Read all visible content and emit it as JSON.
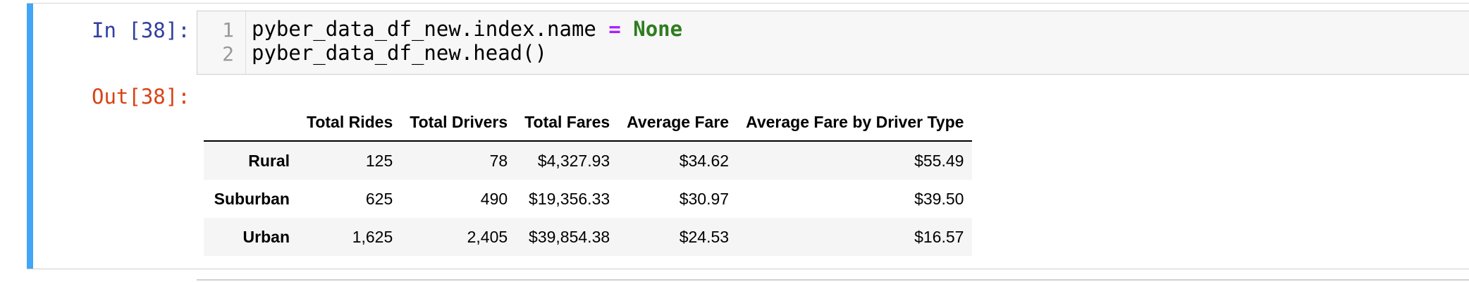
{
  "input_cell": {
    "prompt": "In [38]:",
    "lines": [
      {
        "number": "1",
        "code_prefix": "pyber_data_df_new.index.name ",
        "operator": "=",
        "keyword": " None"
      },
      {
        "number": "2",
        "code": "pyber_data_df_new.head()"
      }
    ]
  },
  "output_cell": {
    "prompt": "Out[38]:",
    "table": {
      "columns": [
        "",
        "Total Rides",
        "Total Drivers",
        "Total Fares",
        "Average Fare",
        "Average Fare by Driver Type"
      ],
      "rows": [
        {
          "index": "Rural",
          "cells": [
            "125",
            "78",
            "$4,327.93",
            "$34.62",
            "$55.49"
          ]
        },
        {
          "index": "Suburban",
          "cells": [
            "625",
            "490",
            "$19,356.33",
            "$30.97",
            "$39.50"
          ]
        },
        {
          "index": "Urban",
          "cells": [
            "1,625",
            "2,405",
            "$39,854.38",
            "$24.53",
            "$16.57"
          ]
        }
      ]
    }
  },
  "colors": {
    "cell_selected_bar": "#42a5f5",
    "in_prompt": "#303f9f",
    "out_prompt": "#d84315",
    "keyword_none": "#2e7d1f",
    "operator": "#aa22ff"
  }
}
